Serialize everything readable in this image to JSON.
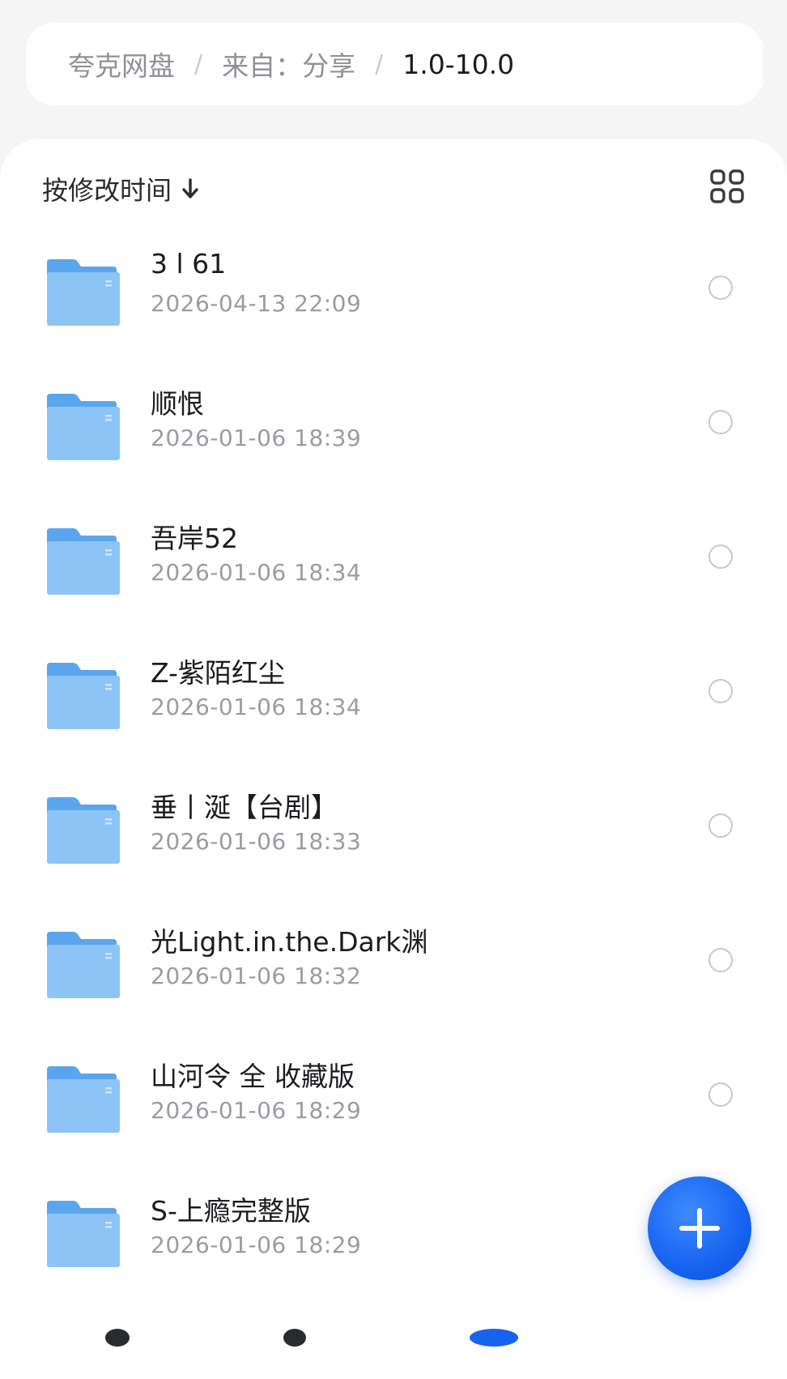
{
  "breadcrumb": {
    "items": [
      "夸克网盘",
      "来自：分享",
      "1.0-10.0"
    ]
  },
  "toolbar": {
    "sort_label": "按修改时间",
    "sort_icon": "arrow-down-icon",
    "view_toggle_icon": "grid-view-icon"
  },
  "files": [
    {
      "name": "3 l 61",
      "time": "2026-04-13 22:09"
    },
    {
      "name": "顺恨",
      "time": "2026-01-06 18:39"
    },
    {
      "name": "吾岸52",
      "time": "2026-01-06 18:34"
    },
    {
      "name": "Z-紫陌红尘",
      "time": "2026-01-06 18:34"
    },
    {
      "name": "垂丨涎【台剧】",
      "time": "2026-01-06 18:33"
    },
    {
      "name": "光Light.in.the.Dark渊",
      "time": "2026-01-06 18:32"
    },
    {
      "name": "山河令 全 收藏版",
      "time": "2026-01-06 18:29"
    },
    {
      "name": "S-上瘾完整版",
      "time": "2026-01-06 18:29"
    }
  ],
  "fab": {
    "icon": "plus-icon"
  },
  "colors": {
    "accent": "#1663f0",
    "folder": "#6fb3f2",
    "background": "#f5f5f6",
    "primary_text": "#1b1c1f",
    "secondary_text": "#9a9ca1"
  }
}
